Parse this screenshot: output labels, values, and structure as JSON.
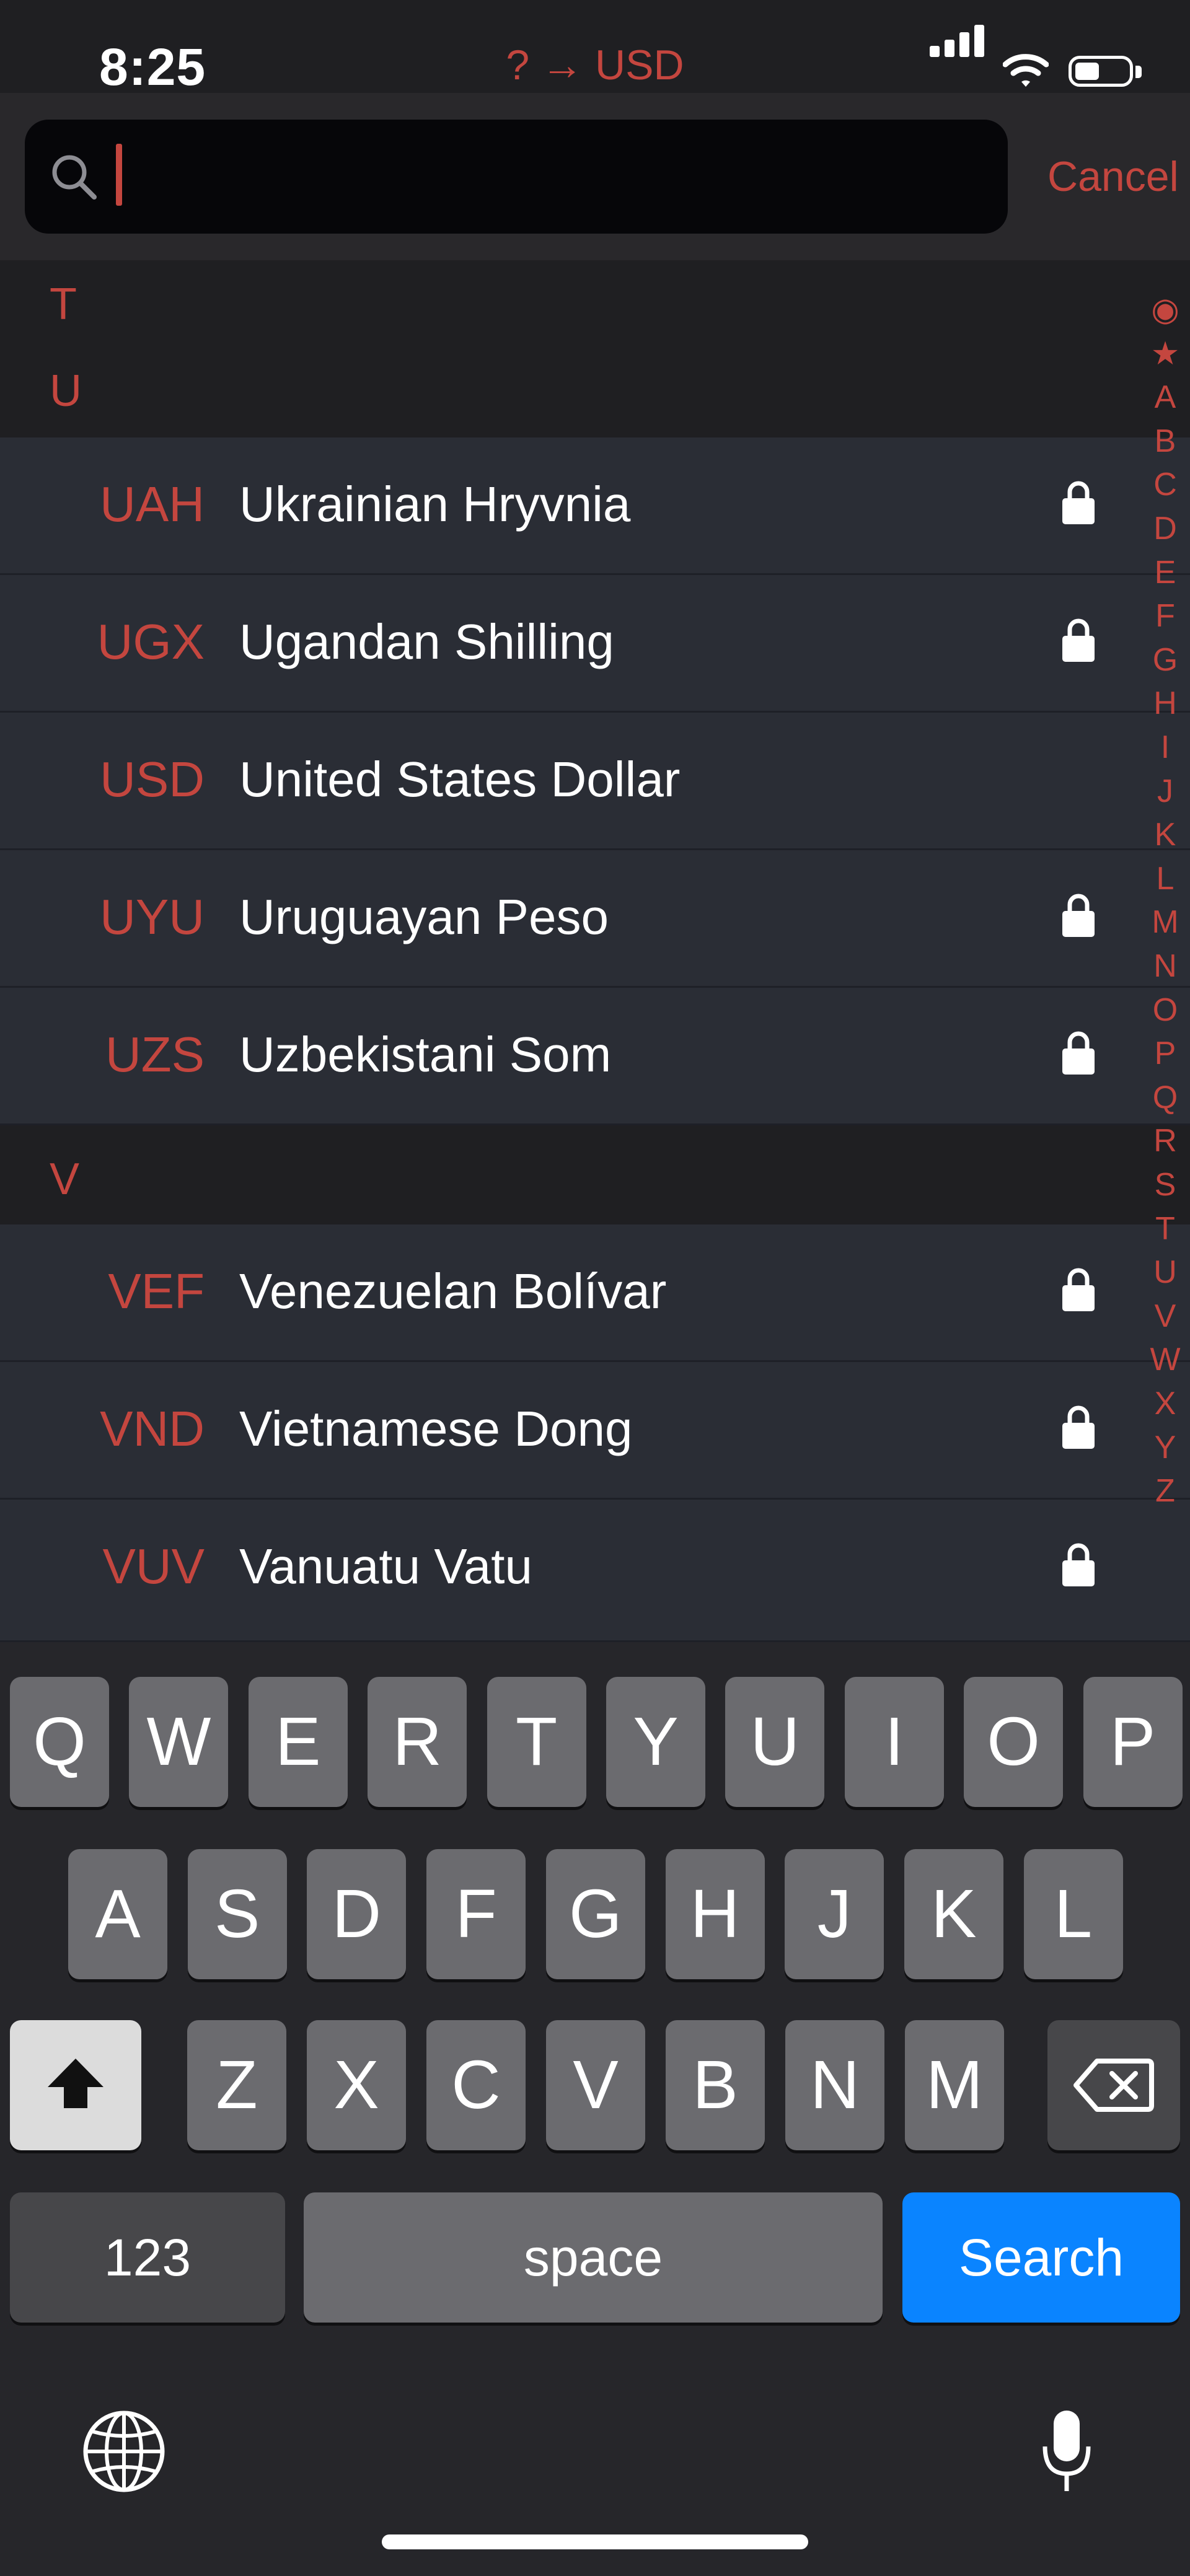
{
  "status": {
    "time": "8:25",
    "title": "? → USD",
    "battery_level": 0.45
  },
  "search": {
    "value": "",
    "cancel_label": "Cancel"
  },
  "sections": [
    {
      "letter": "T",
      "rows": []
    },
    {
      "letter": "U",
      "rows": [
        {
          "code": "UAH",
          "name": "Ukrainian Hryvnia",
          "locked": true
        },
        {
          "code": "UGX",
          "name": "Ugandan Shilling",
          "locked": true
        },
        {
          "code": "USD",
          "name": "United States Dollar",
          "locked": false
        },
        {
          "code": "UYU",
          "name": "Uruguayan Peso",
          "locked": true
        },
        {
          "code": "UZS",
          "name": "Uzbekistani Som",
          "locked": true
        }
      ]
    },
    {
      "letter": "V",
      "rows": [
        {
          "code": "VEF",
          "name": "Venezuelan Bolívar",
          "locked": true
        },
        {
          "code": "VND",
          "name": "Vietnamese Dong",
          "locked": true
        },
        {
          "code": "VUV",
          "name": "Vanuatu Vatu",
          "locked": true
        }
      ]
    }
  ],
  "index": [
    "◉",
    "★",
    "A",
    "B",
    "C",
    "D",
    "E",
    "F",
    "G",
    "H",
    "I",
    "J",
    "K",
    "L",
    "M",
    "N",
    "O",
    "P",
    "Q",
    "R",
    "S",
    "T",
    "U",
    "V",
    "W",
    "X",
    "Y",
    "Z"
  ],
  "keyboard": {
    "row1": [
      "Q",
      "W",
      "E",
      "R",
      "T",
      "Y",
      "U",
      "I",
      "O",
      "P"
    ],
    "row2": [
      "A",
      "S",
      "D",
      "F",
      "G",
      "H",
      "J",
      "K",
      "L"
    ],
    "row3": [
      "Z",
      "X",
      "C",
      "V",
      "B",
      "N",
      "M"
    ],
    "numbers_label": "123",
    "space_label": "space",
    "search_label": "Search"
  },
  "colors": {
    "accent": "#c4463f",
    "row_bg": "#2a2d35",
    "section_bg": "#1f1f22",
    "search_key": "#0a84ff"
  },
  "icons": [
    "search-icon",
    "lock-icon",
    "shift-icon",
    "backspace-icon",
    "globe-icon",
    "microphone-icon",
    "wifi-icon",
    "signal-icon",
    "battery-icon"
  ]
}
